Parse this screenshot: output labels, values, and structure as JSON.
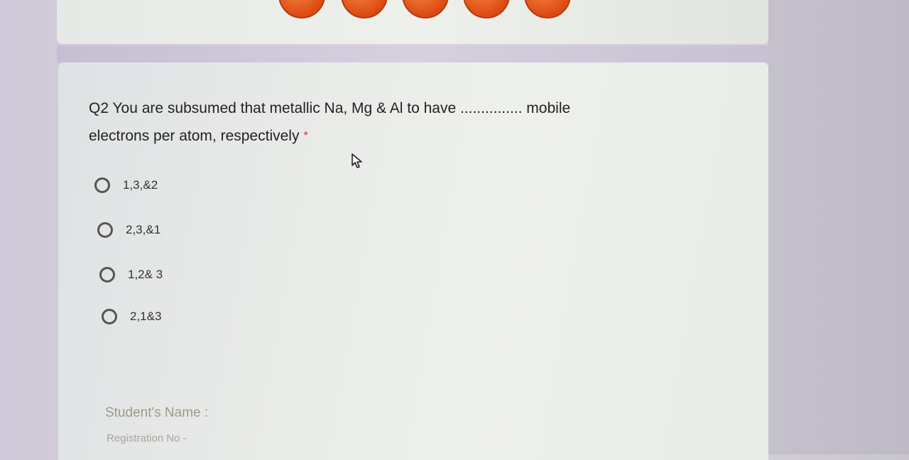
{
  "question": {
    "text_line1": "Q2 You are subsumed that metallic Na, Mg & Al to have ............... mobile",
    "text_line2": "electrons per atom, respectively",
    "required_mark": "*"
  },
  "options": [
    {
      "label": "1,3,&2"
    },
    {
      "label": "2,3,&1"
    },
    {
      "label": "1,2& 3"
    },
    {
      "label": "2,1&3"
    }
  ],
  "footer": {
    "student_name_label": "Student's Name :",
    "registration_label": "Registration No -"
  },
  "colors": {
    "accent_ball": "#dd4a12",
    "required": "#d93025"
  }
}
